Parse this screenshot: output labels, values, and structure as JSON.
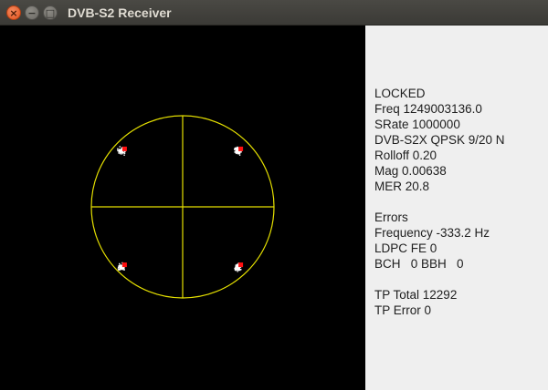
{
  "window": {
    "title": "DVB-S2 Receiver",
    "close_glyph": "×",
    "minimize_glyph": "−",
    "maximize_glyph": "□"
  },
  "constellation": {
    "circle_color": "#e5e000",
    "symbol_color": "#ffffff",
    "ideal_point_color": "#ff1010",
    "background": "#000000"
  },
  "info": {
    "lines": [
      "LOCKED",
      "Freq 1249003136.0",
      "SRate 1000000",
      "DVB-S2X QPSK 9/20 N",
      "Rolloff 0.20",
      "Mag 0.00638",
      "MER 20.8",
      "",
      "Errors",
      "Frequency -333.2 Hz",
      "LDPC FE 0",
      "BCH   0 BBH   0",
      "",
      "TP Total 12292",
      "TP Error 0"
    ]
  }
}
